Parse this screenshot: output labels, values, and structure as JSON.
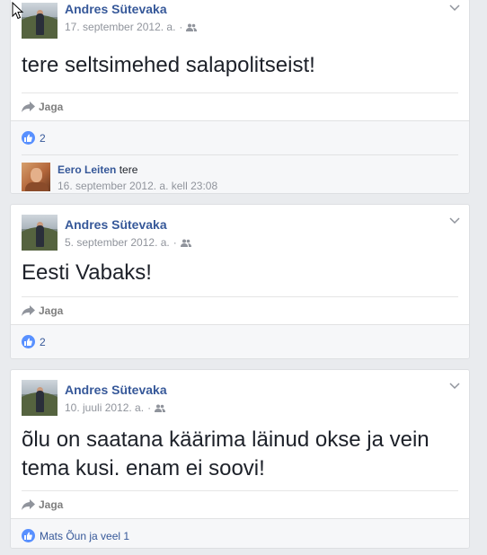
{
  "posts": [
    {
      "author": "Andres Sütevaka",
      "date": "17. september 2012. a.",
      "separator": "·",
      "text": "tere seltsimehed salapolitseist!",
      "share_label": "Jaga",
      "likes": "2",
      "comment": {
        "author": "Eero Leiten",
        "text": "tere",
        "time": "16. september 2012. a. kell 23:08"
      }
    },
    {
      "author": "Andres Sütevaka",
      "date": "5. september 2012. a.",
      "separator": "·",
      "text": "Eesti Vabaks!",
      "share_label": "Jaga",
      "likes": "2"
    },
    {
      "author": "Andres Sütevaka",
      "date": "10. juuli 2012. a.",
      "separator": "·",
      "text": "õlu on saatana käärima läinud okse ja vein tema kusi. enam ei soovi!",
      "share_label": "Jaga",
      "likes": "Mats Õun ja veel 1"
    }
  ],
  "icons": {
    "audience": "friends-icon",
    "share": "share-arrow-icon",
    "like": "thumbs-up-icon",
    "menu": "chevron-down-icon",
    "cursor": "mouse-cursor-icon"
  },
  "colors": {
    "link": "#365899",
    "meta": "#90949c",
    "like_badge": "#5890ff",
    "background": "#e9ebee"
  }
}
